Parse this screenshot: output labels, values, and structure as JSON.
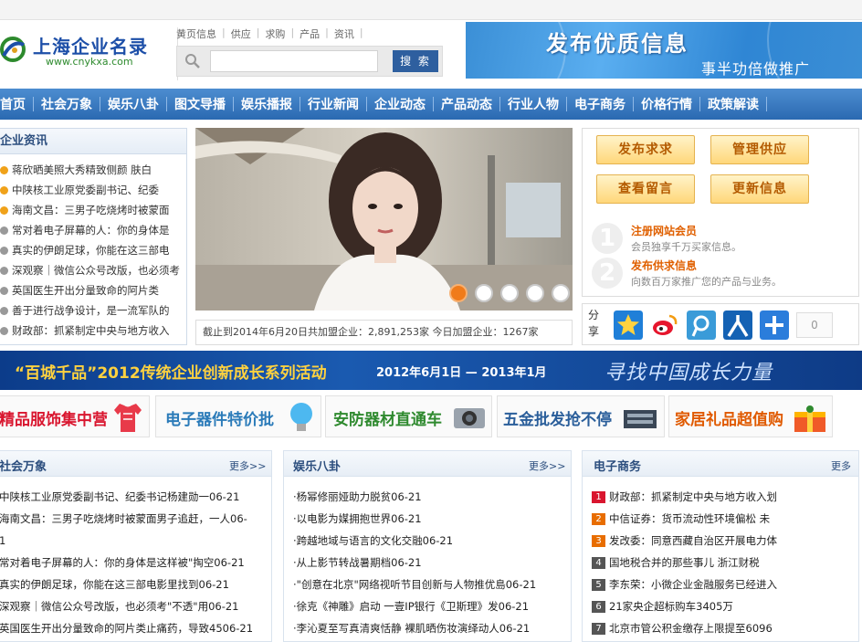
{
  "header": {
    "logo_title": "上海企业名录",
    "logo_url": "www.cnykxa.com",
    "top_links": [
      "黄页信息",
      "供应",
      "求购",
      "产品",
      "资讯"
    ],
    "search": {
      "placeholder": "",
      "button": "搜 索"
    },
    "banner": {
      "title": "发布优质信息",
      "subtitle": "事半功倍做推广"
    }
  },
  "main_nav": [
    "首页",
    "社会万象",
    "娱乐八卦",
    "图文导播",
    "娱乐播报",
    "行业新闻",
    "企业动态",
    "产品动态",
    "行业人物",
    "电子商务",
    "价格行情",
    "政策解读"
  ],
  "news_panel": {
    "title": "企业资讯",
    "items": [
      {
        "text": "蒋欣晒美照大秀精致侧颜 肤白",
        "dot": "#f0a21a"
      },
      {
        "text": "中陕核工业原党委副书记、纪委",
        "dot": "#f0a21a"
      },
      {
        "text": "海南文昌：三男子吃烧烤时被蒙面",
        "dot": "#f0a21a"
      },
      {
        "text": "常对着电子屏幕的人：你的身体是",
        "dot": "#999999"
      },
      {
        "text": "真实的伊朗足球，你能在这三部电",
        "dot": "#999999"
      },
      {
        "text": "深观察｜微信公众号改版，也必须考",
        "dot": "#999999"
      },
      {
        "text": "英国医生开出分量致命的阿片类",
        "dot": "#999999"
      },
      {
        "text": "善于进行战争设计，是一流军队的",
        "dot": "#999999"
      },
      {
        "text": "财政部：抓紧制定中央与地方收入",
        "dot": "#999999"
      }
    ]
  },
  "slider": {
    "active_dot": 1,
    "dot_count": 5
  },
  "stats_text": "截止到2014年6月20日共加盟企业：2,891,253家 今日加盟企业：1267家",
  "actions": {
    "buttons": [
      "发布求求",
      "管理供应",
      "查看留言",
      "更新信息"
    ],
    "steps": [
      {
        "num": "1",
        "title": "注册网站会员",
        "desc": "会员独享千万买家信息。"
      },
      {
        "num": "2",
        "title": "发布供求信息",
        "desc": "向数百万家推广您的产品与业务。"
      }
    ]
  },
  "share": {
    "label": "分享",
    "count": "0",
    "icons": [
      "qzone-icon",
      "weibo-icon",
      "tencent-weibo-icon",
      "renren-icon",
      "more-share-icon"
    ]
  },
  "banner_mid": {
    "title": "“百城千品”2012传统企业创新成长系列活动",
    "date": "2012年6月1日 — 2013年1月",
    "slogan": "寻找中国成长力量"
  },
  "categories": [
    {
      "text": "精品服饰集中营",
      "color": "#d9162f"
    },
    {
      "text": "电子器件特价批",
      "color": "#2b7bb9"
    },
    {
      "text": "安防器材直通车",
      "color": "#2f8a2f"
    },
    {
      "text": "五金批发抢不停",
      "color": "#2a5e9a"
    },
    {
      "text": "家居礼品超值购",
      "color": "#e05a00"
    }
  ],
  "columns": [
    {
      "title": "社会万象",
      "more": "更多>>",
      "items": [
        "中陕核工业原党委副书记、纪委书记杨建勋一06-21",
        "海南文昌：三男子吃烧烤时被蒙面男子追赶，一人06-",
        "1",
        "常对着电子屏幕的人：你的身体是这样被\"掏空06-21",
        "真实的伊朗足球，你能在这三部电影里找到06-21",
        "深观察｜微信公众号改版，也必须考\"不透\"用06-21",
        "英国医生开出分量致命的阿片类止痛药，导致4506-21"
      ]
    },
    {
      "title": "娱乐八卦",
      "more": "更多>>",
      "items": [
        "·杨幂修丽娅助力脱贫06-21",
        "·以电影为媒拥抱世界06-21",
        "·跨越地域与语言的文化交融06-21",
        "·从上影节转战暑期档06-21",
        "·\"创意在北京\"网络视听节目创新与人物推优島06-21",
        "·徐克《神雕》启动 一壹IP银行《卫斯理》发06-21",
        "·李沁夏至写真清爽恬静 裸肌晒伤妆演绎动人06-21"
      ]
    },
    {
      "title": "电子商务",
      "more": "更多",
      "items": [
        {
          "rank": "1",
          "text": "财政部：抓紧制定中央与地方收入划"
        },
        {
          "rank": "2",
          "text": "中信证券：货币流动性环境偏松 未"
        },
        {
          "rank": "3",
          "text": "发改委：同意西藏自治区开展电力体"
        },
        {
          "rank": "4",
          "text": "国地税合并的那些事儿 浙江财税"
        },
        {
          "rank": "5",
          "text": "李东荣：小微企业金融服务已经进入"
        },
        {
          "rank": "6",
          "text": "21家央企超标购车3405万"
        },
        {
          "rank": "7",
          "text": "北京市管公积金缴存上限提至6096"
        }
      ],
      "rank_colors": [
        "#d9162f",
        "#e86d00",
        "#e86d00",
        "#555555",
        "#555555",
        "#555555",
        "#555555"
      ]
    }
  ]
}
